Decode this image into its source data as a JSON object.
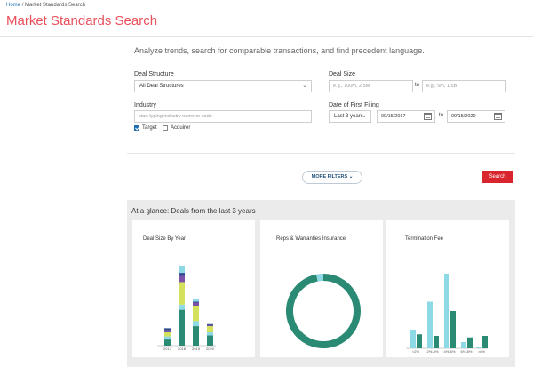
{
  "breadcrumb": {
    "home": "Home",
    "sep": "/",
    "current": "Market Standards Search"
  },
  "page": {
    "title": "Market Standards Search",
    "intro": "Analyze trends, search for comparable transactions, and find precedent language."
  },
  "form": {
    "deal_structure": {
      "label": "Deal Structure",
      "value": "All Deal Structures"
    },
    "deal_size": {
      "label": "Deal Size",
      "min_placeholder": "e.g., 100m, 2.5M",
      "to": "to",
      "max_placeholder": "e.g., 5m, 1.5B"
    },
    "industry": {
      "label": "Industry",
      "placeholder": "start typing industry name or code"
    },
    "target": {
      "label": "Target",
      "checked": true
    },
    "acquirer": {
      "label": "Acquirer",
      "checked": false
    },
    "first_filing": {
      "label": "Date of First Filing",
      "range": "Last 3 years",
      "from": "09/15/2017",
      "to": "to",
      "until": "09/15/2020"
    }
  },
  "actions": {
    "more_filters": "MORE FILTERS",
    "search": "Search"
  },
  "colors": {
    "accent": "#e8505b",
    "link": "#1f6fb2",
    "search": "#d9262e",
    "teal": "#2a8a73",
    "light_blue": "#8ed9e6",
    "lime": "#d4e15c",
    "purple": "#7b52a8",
    "navy": "#2f4b8c"
  },
  "glance": {
    "title": "At a glance: Deals from the last 3 years",
    "cards": [
      {
        "title": "Deal Size By Year"
      },
      {
        "title": "Reps & Warranties Insurance"
      },
      {
        "title": "Termination Fee"
      }
    ]
  },
  "chart_data": [
    {
      "type": "bar",
      "title": "Deal Size By Year",
      "stacked": true,
      "categories": [
        "2017",
        "2018",
        "2019",
        "2020"
      ],
      "series": [
        {
          "color": "#2a8a73",
          "values": [
            6,
            35,
            19,
            10
          ]
        },
        {
          "color": "#8ed9e6",
          "values": [
            3,
            5,
            5,
            3
          ]
        },
        {
          "color": "#d4e15c",
          "values": [
            4,
            22,
            15,
            6
          ]
        },
        {
          "color": "#7b52a8",
          "values": [
            2,
            6,
            3,
            1
          ]
        },
        {
          "color": "#2f4b8c",
          "values": [
            2,
            3,
            1,
            1
          ]
        },
        {
          "color": "#8ed9e6",
          "values": [
            0,
            7,
            3,
            0
          ]
        }
      ]
    },
    {
      "type": "pie",
      "title": "Reps & Warranties Insurance",
      "donut": true,
      "slices": [
        {
          "color": "#2a8a73",
          "value": 97
        },
        {
          "color": "#8ed9e6",
          "value": 3
        }
      ]
    },
    {
      "type": "bar",
      "title": "Termination Fee",
      "categories": [
        "<2%",
        "2%-4%",
        "4%-6%",
        "6%-8%",
        ">8%"
      ],
      "series": [
        {
          "color": "#8ed9e6",
          "values": [
            12,
            30,
            48,
            4,
            1
          ]
        },
        {
          "color": "#2a8a73",
          "values": [
            9,
            8,
            24,
            7,
            8
          ]
        }
      ]
    }
  ]
}
